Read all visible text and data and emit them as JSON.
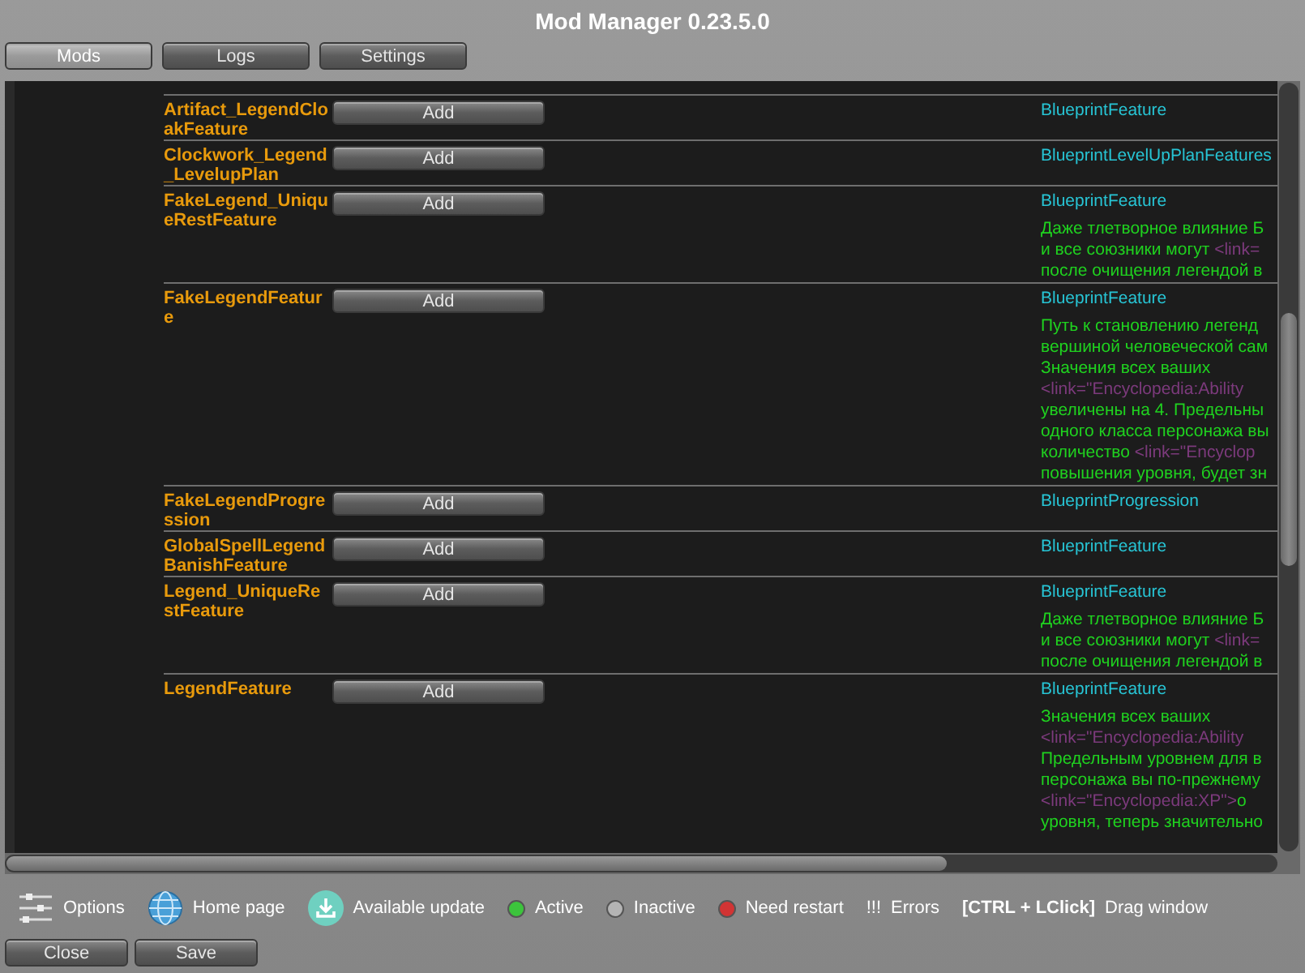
{
  "window": {
    "title": "Mod Manager 0.23.5.0"
  },
  "tabs": [
    {
      "label": "Mods",
      "selected": true
    },
    {
      "label": "Logs",
      "selected": false
    },
    {
      "label": "Settings",
      "selected": false
    }
  ],
  "mods": [
    {
      "name": "Artifact_LegendCloakFeature",
      "button": "Add",
      "type": "BlueprintFeature"
    },
    {
      "name": "Clockwork_Legend_LevelupPlan",
      "button": "Add",
      "type": "BlueprintLevelUpPlanFeatures"
    },
    {
      "name": "FakeLegend_UniqueRestFeature",
      "button": "Add",
      "type": "BlueprintFeature",
      "description": [
        [
          {
            "kind": "text",
            "text": "Даже тлетворное влияние Б"
          }
        ],
        [
          {
            "kind": "text",
            "text": "и все союзники могут "
          },
          {
            "kind": "link",
            "text": "<link="
          }
        ],
        [
          {
            "kind": "text",
            "text": "после очищения легендой в"
          }
        ]
      ]
    },
    {
      "name": "FakeLegendFeature",
      "button": "Add",
      "type": "BlueprintFeature",
      "description": [
        [
          {
            "kind": "text",
            "text": "Путь к становлению легенд"
          }
        ],
        [
          {
            "kind": "text",
            "text": "вершиной человеческой сам"
          }
        ],
        [
          {
            "kind": "text",
            "text": "Значения всех ваших"
          }
        ],
        [
          {
            "kind": "link",
            "text": "<link=\"Encyclopedia:Ability"
          }
        ],
        [
          {
            "kind": "text",
            "text": "увеличены на 4. Предельны"
          }
        ],
        [
          {
            "kind": "text",
            "text": "одного класса персонажа вы"
          }
        ],
        [
          {
            "kind": "text",
            "text": "количество "
          },
          {
            "kind": "link",
            "text": "<link=\"Encyclop"
          }
        ],
        [
          {
            "kind": "text",
            "text": "повышения уровня, будет зн"
          }
        ]
      ]
    },
    {
      "name": "FakeLegendProgression",
      "button": "Add",
      "type": "BlueprintProgression"
    },
    {
      "name": "GlobalSpellLegendBanishFeature",
      "button": "Add",
      "type": "BlueprintFeature"
    },
    {
      "name": "Legend_UniqueRestFeature",
      "button": "Add",
      "type": "BlueprintFeature",
      "description": [
        [
          {
            "kind": "text",
            "text": "Даже тлетворное влияние Б"
          }
        ],
        [
          {
            "kind": "text",
            "text": "и все союзники могут "
          },
          {
            "kind": "link",
            "text": "<link="
          }
        ],
        [
          {
            "kind": "text",
            "text": "после очищения легендой в"
          }
        ]
      ]
    },
    {
      "name": "LegendFeature",
      "button": "Add",
      "type": "BlueprintFeature",
      "description": [
        [
          {
            "kind": "text",
            "text": "Значения всех ваших"
          }
        ],
        [
          {
            "kind": "link",
            "text": "<link=\"Encyclopedia:Ability"
          }
        ],
        [
          {
            "kind": "text",
            "text": "Предельным уровнем для в"
          }
        ],
        [
          {
            "kind": "text",
            "text": "персонажа вы по-прежнему"
          }
        ],
        [
          {
            "kind": "link",
            "text": "<link=\"Encyclopedia:XP\">"
          },
          {
            "kind": "text",
            "text": "о"
          }
        ],
        [
          {
            "kind": "text",
            "text": "уровня, теперь значительно"
          }
        ]
      ]
    }
  ],
  "legend": [
    {
      "kind": "options",
      "label": "Options"
    },
    {
      "kind": "web",
      "label": "Home page"
    },
    {
      "kind": "update",
      "label": "Available update"
    },
    {
      "kind": "dot",
      "color": "#3cc43c",
      "label": "Active"
    },
    {
      "kind": "dot",
      "color": "#b4b4b4",
      "label": "Inactive"
    },
    {
      "kind": "dot",
      "color": "#d23434",
      "label": "Need restart"
    },
    {
      "kind": "errors",
      "mark": "!!!",
      "label": "Errors"
    },
    {
      "kind": "hotkey",
      "keys": "[CTRL + LClick]",
      "label": "Drag window"
    }
  ],
  "buttons": [
    "Close",
    "Save"
  ]
}
